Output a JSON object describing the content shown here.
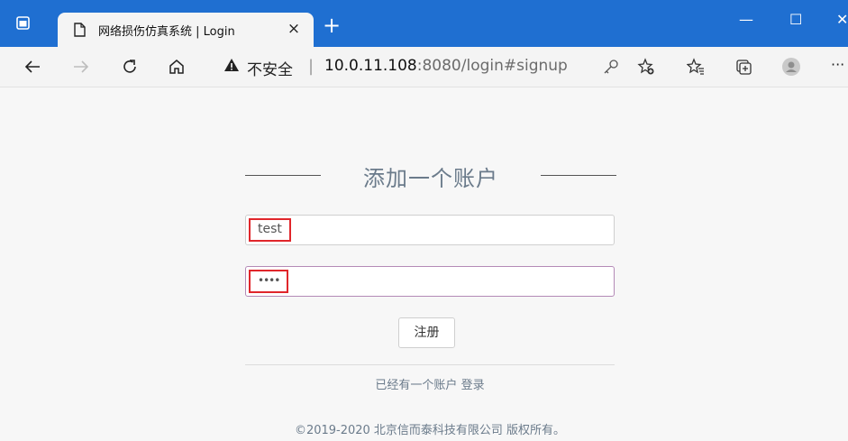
{
  "browser": {
    "tab_title": "网络损伤仿真系统 | Login",
    "tab_close": "×",
    "new_tab": "+",
    "window_controls": {
      "minimize": "—",
      "maximize": "☐",
      "close": "✕"
    },
    "address": {
      "security_label": "不安全",
      "separator": "|",
      "host": "10.0.11.108",
      "rest": ":8080/login#signup"
    },
    "menu": "···"
  },
  "page": {
    "heading": "添加一个账户",
    "username_value": "test",
    "password_value": "••••",
    "register_button": "注册",
    "have_account_text": "已经有一个账户",
    "login_link": "登录",
    "footer": "©2019-2020 北京信而泰科技有限公司 版权所有。"
  },
  "colors": {
    "titlebar": "#1f6fd1",
    "highlight": "#e0262b",
    "heading": "#6b7b8b"
  }
}
